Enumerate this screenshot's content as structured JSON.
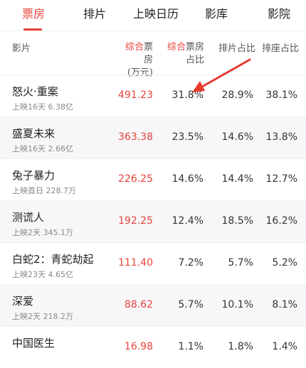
{
  "tabs": [
    {
      "label": "票房",
      "active": true
    },
    {
      "label": "排片",
      "active": false
    },
    {
      "label": "上映日历",
      "active": false
    },
    {
      "label": "影库",
      "active": false
    },
    {
      "label": "影院",
      "active": false
    }
  ],
  "header": {
    "film": "影片",
    "box_office_accent": "综合",
    "box_office_rest": "票房",
    "box_office_unit": "(万元)",
    "share_accent": "综合",
    "share_rest": "票房",
    "share_line2": "占比",
    "schedule_share": "排片占比",
    "seat_share": "排座占比"
  },
  "rows": [
    {
      "title": "怒火·重案",
      "sub": "上映16天 6.38亿",
      "box": "491.23",
      "share": "31.8%",
      "sched": "28.9%",
      "seat": "38.1%"
    },
    {
      "title": "盛夏未来",
      "sub": "上映16天 2.66亿",
      "box": "363.38",
      "share": "23.5%",
      "sched": "14.6%",
      "seat": "13.8%"
    },
    {
      "title": "兔子暴力",
      "sub": "上映首日 228.7万",
      "box": "226.25",
      "share": "14.6%",
      "sched": "14.4%",
      "seat": "12.7%"
    },
    {
      "title": "测谎人",
      "sub": "上映2天 345.1万",
      "box": "192.25",
      "share": "12.4%",
      "sched": "18.5%",
      "seat": "16.2%"
    },
    {
      "title": "白蛇2：青蛇劫起",
      "sub": "上映23天 4.65亿",
      "box": "111.40",
      "share": "7.2%",
      "sched": "5.7%",
      "seat": "5.2%"
    },
    {
      "title": "深爱",
      "sub": "上映2天 218.2万",
      "box": "88.62",
      "share": "5.7%",
      "sched": "10.1%",
      "seat": "8.1%"
    },
    {
      "title": "中国医生",
      "sub": "",
      "box": "16.98",
      "share": "1.1%",
      "sched": "1.8%",
      "seat": "1.4%"
    }
  ],
  "colors": {
    "accent": "#e8433b",
    "arrow": "#e53a2f"
  }
}
